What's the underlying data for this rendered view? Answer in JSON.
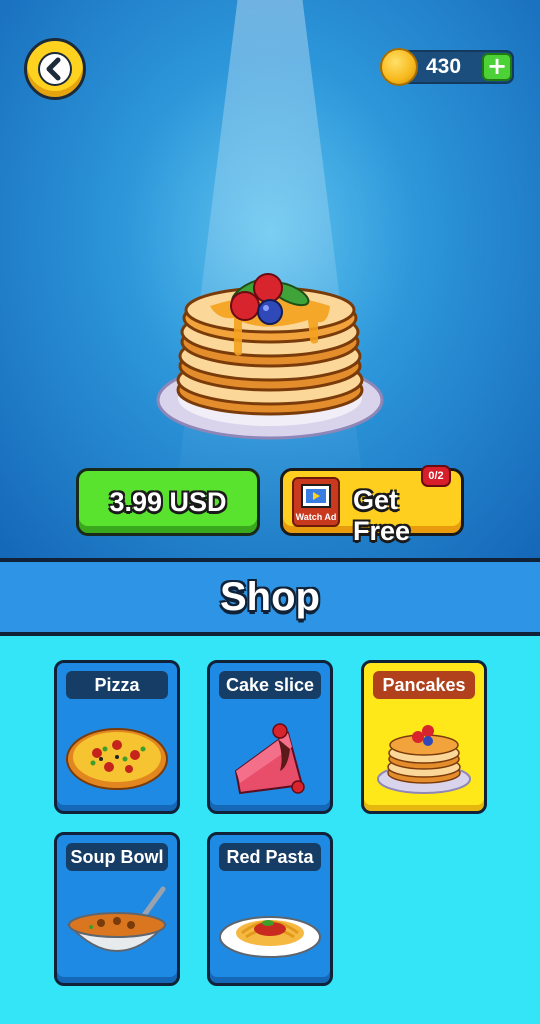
{
  "coins": {
    "amount": "430"
  },
  "buy": {
    "price_label": "3.99 USD"
  },
  "free": {
    "label": "Get Free",
    "watch_ad_label": "Watch Ad",
    "badge": "0/2"
  },
  "shop": {
    "title": "Shop"
  },
  "items": [
    {
      "label": "Pizza",
      "selected": false
    },
    {
      "label": "Cake slice",
      "selected": false
    },
    {
      "label": "Pancakes",
      "selected": true
    },
    {
      "label": "Soup Bowl",
      "selected": false
    },
    {
      "label": "Red Pasta",
      "selected": false
    }
  ],
  "icons": {
    "back": "chevron-left-icon",
    "coin": "coin-icon",
    "add": "plus-icon",
    "watch_ad": "video-icon"
  },
  "colors": {
    "buy_button": "#5ae32e",
    "free_button": "#ffcf1f",
    "shop_header": "#2e95e6",
    "grid_background": "#33e5f7",
    "selected_card": "#ffe81a"
  }
}
